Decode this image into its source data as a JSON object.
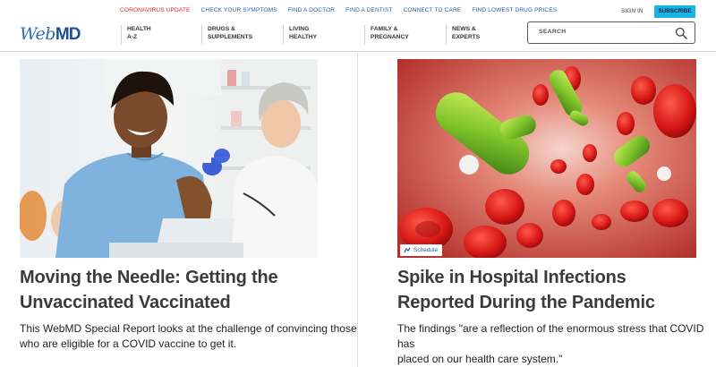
{
  "top_links": [
    {
      "label": "CORONAVIRUS UPDATE",
      "alert": true
    },
    {
      "label": "CHECK YOUR SYMPTOMS"
    },
    {
      "label": "FIND A DOCTOR"
    },
    {
      "label": "FIND A DENTIST"
    },
    {
      "label": "CONNECT TO CARE"
    },
    {
      "label": "FIND LOWEST DRUG PRICES"
    }
  ],
  "account": {
    "sign_in": "SIGN IN",
    "subscribe": "SUBSCRIBE"
  },
  "logo": {
    "web": "Web",
    "md": "MD"
  },
  "nav": [
    {
      "line1": "HEALTH",
      "line2": "A-Z"
    },
    {
      "line1": "DRUGS &",
      "line2": "SUPPLEMENTS"
    },
    {
      "line1": "LIVING",
      "line2": "HEALTHY"
    },
    {
      "line1": "FAMILY &",
      "line2": "PREGNANCY"
    },
    {
      "line1": "NEWS &",
      "line2": "EXPERTS"
    }
  ],
  "search": {
    "placeholder": "SEARCH",
    "icon": "magnifier-icon"
  },
  "articles": [
    {
      "title_line1": "Moving the Needle: Getting the",
      "title_line2": "Unvaccinated Vaccinated",
      "desc_line1": "This WebMD Special Report looks at the challenge of convincing those",
      "desc_line2": "who are eligible for a COVID vaccine to get it.",
      "image": "vaccination-photo"
    },
    {
      "title_line1": "Spike in Hospital Infections",
      "title_line2": "Reported During the Pandemic",
      "desc_line1": "The findings \"are a reflection of the enormous stress that COVID has",
      "desc_line2": "placed on our health care system.\"",
      "image": "bacteria-illustration",
      "badge": "Schedule"
    }
  ],
  "colors": {
    "brand": "#2c6cb5",
    "alert": "#e0262c",
    "link": "#2a5ea8",
    "subscribe_bg": "#19b3e6"
  }
}
